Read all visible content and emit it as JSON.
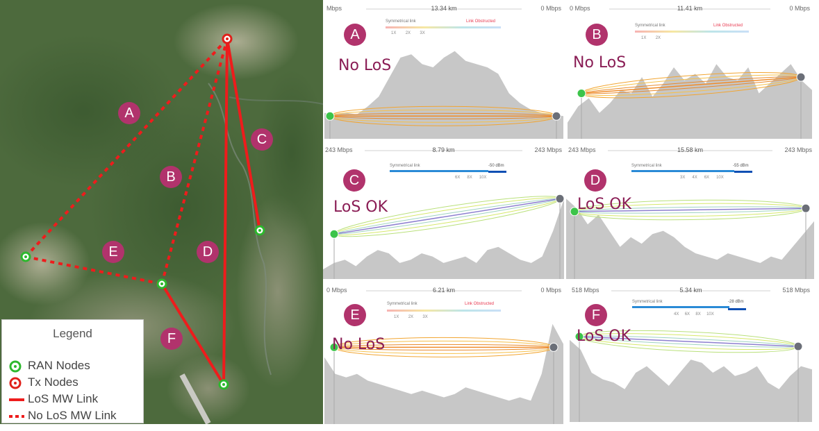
{
  "map": {
    "link_labels": [
      "A",
      "B",
      "C",
      "D",
      "E",
      "F"
    ],
    "legend": {
      "title": "Legend",
      "items": [
        {
          "icon": "ran-node-icon",
          "label": "RAN Nodes"
        },
        {
          "icon": "tx-node-icon",
          "label": "Tx Nodes"
        },
        {
          "icon": "los-link-icon",
          "label": "LoS MW Link"
        },
        {
          "icon": "nolos-link-icon",
          "label": "No LoS MW Link"
        }
      ]
    },
    "colors": {
      "ran_node": "#2db82d",
      "tx_node": "#e0201a",
      "link": "#ee1c1c",
      "label_circle": "#b1336c"
    }
  },
  "panels": [
    {
      "id": "A",
      "left_rate": "Mbps",
      "distance": "13.34 km",
      "right_rate": "0 Mbps",
      "status": "No LoS",
      "legend_left": "Symmetrical link",
      "legend_right": "Link Obstructed",
      "multipliers": [
        "1X",
        "2X",
        "3X"
      ],
      "obstructed": true
    },
    {
      "id": "B",
      "left_rate": "0 Mbps",
      "distance": "11.41 km",
      "right_rate": "0 Mbps",
      "status": "No LoS",
      "legend_left": "Symmetrical link",
      "legend_right": "Link Obstructed",
      "multipliers": [
        "1X",
        "2X"
      ],
      "obstructed": true
    },
    {
      "id": "C",
      "left_rate": "243 Mbps",
      "distance": "8.79 km",
      "right_rate": "243 Mbps",
      "status": "LoS OK",
      "legend_left": "Symmetrical link",
      "legend_right": "-50 dBm",
      "multipliers": [
        "6X",
        "8X",
        "10X"
      ],
      "obstructed": false
    },
    {
      "id": "D",
      "left_rate": "243 Mbps",
      "distance": "15.58 km",
      "right_rate": "243 Mbps",
      "status": "LoS OK",
      "legend_left": "Symmetrical link",
      "legend_right": "-55 dBm",
      "multipliers": [
        "3X",
        "4X",
        "6X",
        "10X"
      ],
      "obstructed": false
    },
    {
      "id": "E",
      "left_rate": "0 Mbps",
      "distance": "6.21 km",
      "right_rate": "0 Mbps",
      "status": "No LoS",
      "legend_left": "Symmetrical link",
      "legend_right": "Link Obstructed",
      "multipliers": [
        "1X",
        "2X",
        "3X"
      ],
      "obstructed": true
    },
    {
      "id": "F",
      "left_rate": "518 Mbps",
      "distance": "5.34 km",
      "right_rate": "518 Mbps",
      "status": "LoS OK",
      "legend_left": "Symmetrical link",
      "legend_right": "-28 dBm",
      "multipliers": [
        "4X",
        "6X",
        "8X",
        "10X"
      ],
      "obstructed": false
    }
  ]
}
